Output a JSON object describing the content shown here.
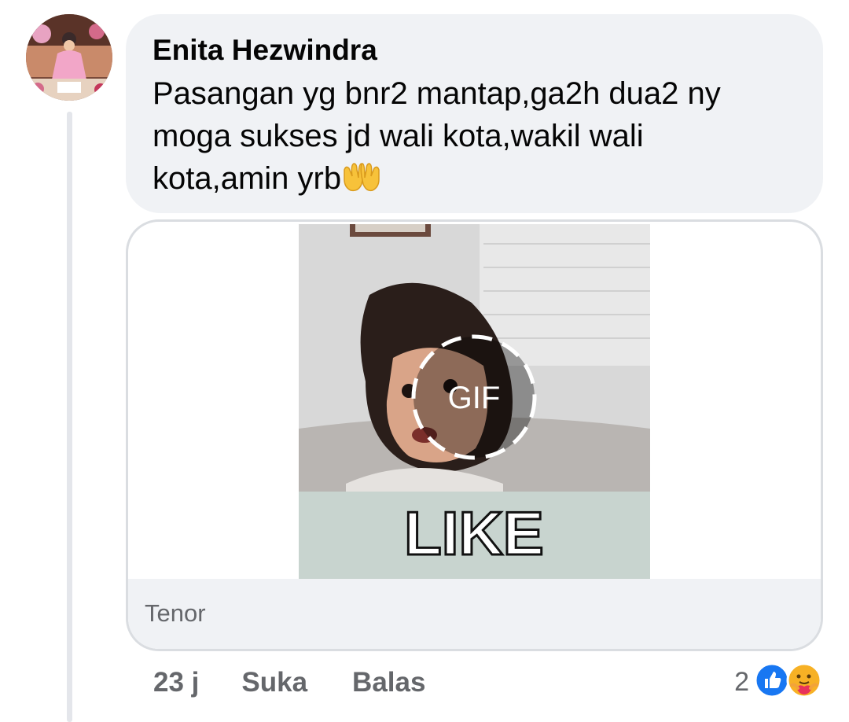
{
  "comment": {
    "author": "Enita Hezwindra",
    "text": "Pasangan yg bnr2 mantap,ga2h dua2 ny moga sukses jd wali kota,wakil wali kota,amin yrb",
    "emoji_name": "palms-up-together-emoji",
    "avatar": "user-avatar-photo"
  },
  "gif": {
    "badge": "GIF",
    "caption": "LIKE",
    "source": "Tenor"
  },
  "actions": {
    "time": "23 j",
    "like": "Suka",
    "reply": "Balas"
  },
  "reactions": {
    "count": "2",
    "icons": [
      "like-reaction-icon",
      "care-reaction-icon"
    ],
    "like_color": "#1877f2",
    "care_color": "#f7b125"
  }
}
